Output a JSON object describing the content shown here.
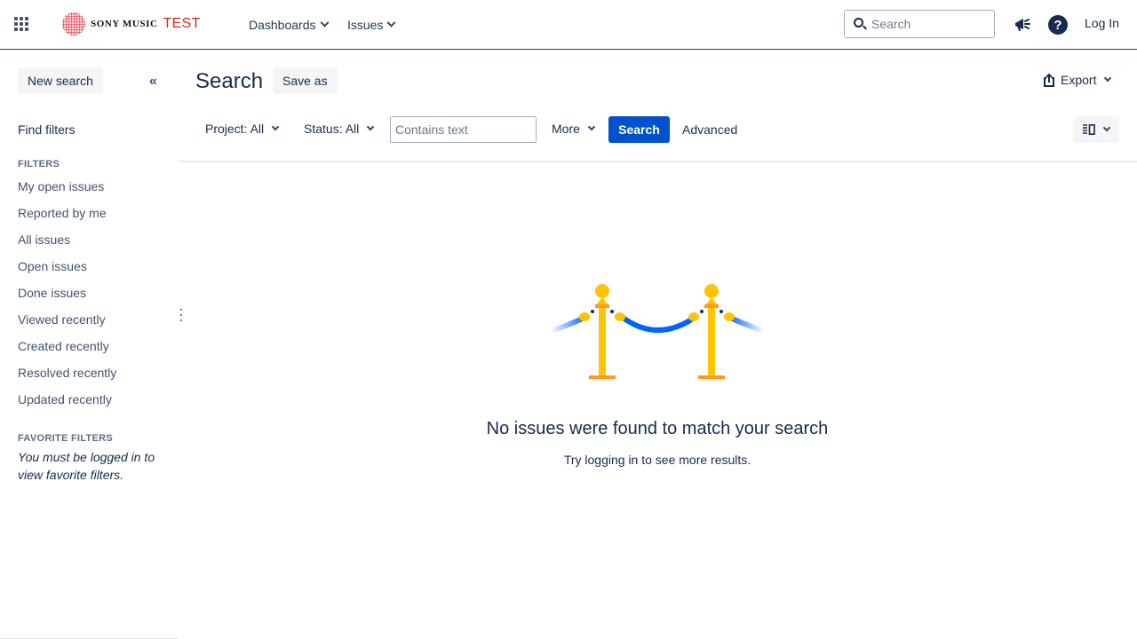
{
  "header": {
    "brand": "SONY MUSIC",
    "env": "TEST",
    "nav": [
      {
        "label": "Dashboards"
      },
      {
        "label": "Issues"
      }
    ],
    "search_placeholder": "Search",
    "login_label": "Log In"
  },
  "sidebar": {
    "new_search": "New search",
    "find_filters": "Find filters",
    "filters_heading": "FILTERS",
    "filters": [
      "My open issues",
      "Reported by me",
      "All issues",
      "Open issues",
      "Done issues",
      "Viewed recently",
      "Created recently",
      "Resolved recently",
      "Updated recently"
    ],
    "favorite_heading": "FAVORITE FILTERS",
    "favorite_note": "You must be logged in to view favorite filters."
  },
  "main": {
    "title": "Search",
    "save_as": "Save as",
    "export": "Export",
    "filters": {
      "project": "Project: All",
      "status": "Status: All",
      "text_placeholder": "Contains text",
      "more": "More",
      "search_button": "Search",
      "advanced": "Advanced"
    },
    "empty": {
      "title": "No issues were found to match your search",
      "subtitle": "Try logging in to see more results."
    }
  },
  "colors": {
    "primary": "#0052cc",
    "brand_red": "#d0271d",
    "stanchion_gold": "#ffc400",
    "rope_blue": "#0065ff"
  }
}
